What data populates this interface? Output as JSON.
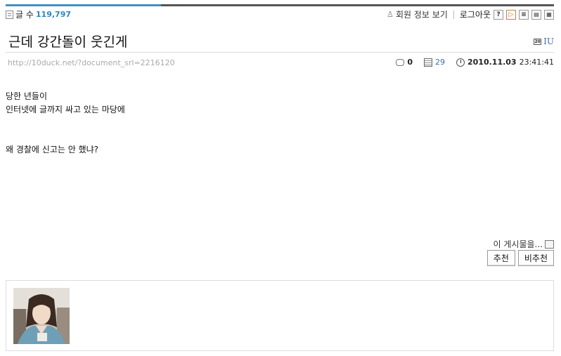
{
  "header": {
    "count_label": "글 수",
    "count_value": "119,797",
    "member_info": "회원 정보 보기",
    "logout": "로그아웃",
    "tools": [
      {
        "name": "help-icon",
        "glyph": "?"
      },
      {
        "name": "play-icon",
        "glyph": "▷"
      },
      {
        "name": "list-view-icon",
        "glyph": "≡"
      },
      {
        "name": "webzine-view-icon",
        "glyph": "▤"
      },
      {
        "name": "gallery-view-icon",
        "glyph": "▦"
      }
    ]
  },
  "post": {
    "title": "근데 강간돌이 웃긴게",
    "author": "IU",
    "url": "http://10duck.net/?document_srl=2216120",
    "comment_count": "0",
    "read_count": "29",
    "date": "2010.11.03",
    "time": "23:41:41",
    "lines": [
      "당한 년들이",
      "인터넷에 글까지 싸고 있는 마당에",
      "",
      "왜 경찰에 신고는 안 했냐?"
    ]
  },
  "actions": {
    "share_label": "이 게시물을...",
    "recommend": "추천",
    "not_recommend": "비추천"
  },
  "colors": {
    "accent": "#3f91c3",
    "link": "#3c6fa8",
    "count": "#2e86b8"
  }
}
